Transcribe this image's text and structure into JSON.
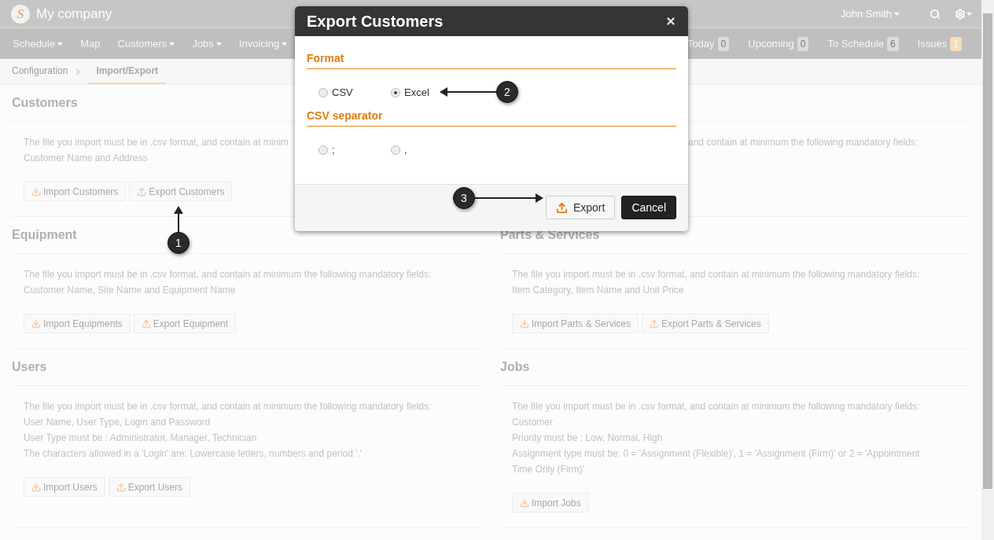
{
  "app": {
    "logo_letter": "S",
    "company": "My company",
    "user": "John Smith"
  },
  "nav": [
    {
      "label": "Schedule",
      "dropdown": true
    },
    {
      "label": "Map",
      "dropdown": false
    },
    {
      "label": "Customers",
      "dropdown": true
    },
    {
      "label": "Jobs",
      "dropdown": true
    },
    {
      "label": "Invoicing",
      "dropdown": true
    }
  ],
  "nav_right": [
    {
      "label": "Today",
      "count": "0",
      "highlight": false
    },
    {
      "label": "Upcoming",
      "count": "0",
      "highlight": false
    },
    {
      "label": "To Schedule",
      "count": "6",
      "highlight": false
    },
    {
      "label": "Issues",
      "count": "1",
      "highlight": true
    }
  ],
  "breadcrumb": [
    {
      "label": "Configuration",
      "selected": false
    },
    {
      "label": "Import/Export",
      "selected": true
    }
  ],
  "sections": [
    {
      "kind": "full",
      "title": "Customers",
      "lines": [
        "The file you import must be in .csv format, and contain at minim",
        "Customer Name and Address"
      ],
      "buttons": [
        {
          "kind": "import",
          "label": "Import Customers"
        },
        {
          "kind": "export",
          "label": "Export Customers"
        }
      ]
    },
    {
      "kind": "covered",
      "lines": [
        "and contain at minimum the following mandatory fields:"
      ]
    },
    {
      "kind": "full",
      "title": "Equipment",
      "lines": [
        "The file you import must be in .csv format, and contain at minimum the following mandatory fields:",
        "Customer Name, Site Name and Equipment Name"
      ],
      "buttons": [
        {
          "kind": "import",
          "label": "Import Equipments"
        },
        {
          "kind": "export",
          "label": "Export Equipment"
        }
      ]
    },
    {
      "kind": "full",
      "title": "Parts & Services",
      "lines": [
        "The file you import must be in .csv format, and contain at minimum the following mandatory fields:",
        "Item Category, Item Name and Unit Price"
      ],
      "buttons": [
        {
          "kind": "import",
          "label": "Import Parts & Services"
        },
        {
          "kind": "export",
          "label": "Export Parts & Services"
        }
      ]
    },
    {
      "kind": "full",
      "title": "Users",
      "lines": [
        "The file you import must be in .csv format, and contain at minimum the following mandatory fields:",
        "User Name, User Type, Login and Password",
        "User Type must be : Administrator, Manager, Technician",
        "The characters allowed in a 'Login' are: Lowercase letters, numbers and period '.'"
      ],
      "buttons": [
        {
          "kind": "import",
          "label": "Import Users"
        },
        {
          "kind": "export",
          "label": "Export Users"
        }
      ]
    },
    {
      "kind": "full",
      "title": "Jobs",
      "lines": [
        "The file you import must be in .csv format, and contain at minimum the following mandatory fields:",
        "Customer",
        "Priority must be : Low, Normal, High",
        "Assignment type must be: 0 = 'Assignment (Flexible)', 1 = 'Assignment (Firm)' or 2 = 'Appointment Time Only (Firm)'"
      ],
      "buttons": [
        {
          "kind": "import",
          "label": "Import Jobs"
        }
      ]
    }
  ],
  "modal": {
    "title": "Export Customers",
    "groups": [
      {
        "title": "Format",
        "options": [
          {
            "label": "CSV",
            "selected": false
          },
          {
            "label": "Excel",
            "selected": true
          }
        ]
      },
      {
        "title": "CSV separator",
        "options": [
          {
            "label": ";",
            "selected": false
          },
          {
            "label": ",",
            "selected": false
          }
        ]
      }
    ],
    "buttons": [
      {
        "kind": "export",
        "label": "Export"
      },
      {
        "kind": "cancel",
        "label": "Cancel"
      }
    ]
  },
  "callouts": [
    {
      "label": "1"
    },
    {
      "label": "2"
    },
    {
      "label": "3"
    }
  ]
}
